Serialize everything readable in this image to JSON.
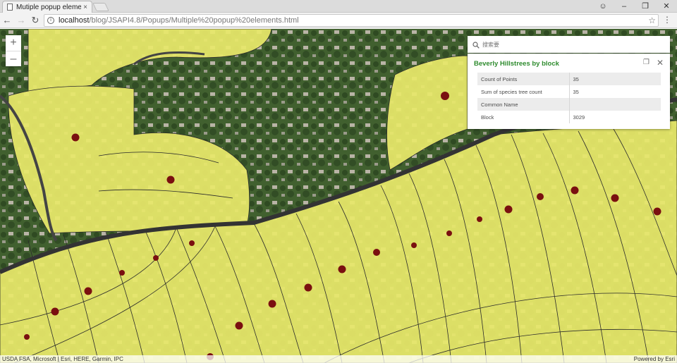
{
  "browser": {
    "tab_title": "Mutiple popup elemen",
    "tab_close": "×",
    "url_host": "localhost",
    "url_path": "/blog/JSAPI4.8/Popups/Multiple%20popup%20elements.html",
    "icons": [
      "document-icon",
      "profile-icon",
      "minimize-icon",
      "restore-icon",
      "close-icon",
      "back-icon",
      "forward-icon",
      "reload-icon",
      "info-icon",
      "star-icon",
      "menu-icon"
    ]
  },
  "map": {
    "zoom_in": "+",
    "zoom_out": "–",
    "attribution": "USDA FSA, Microsoft | Esri, HERE, Garmin, IPC",
    "powered_by": "Powered by Esri",
    "colors": {
      "block_fill": "#e8e86a",
      "block_line": "#2b2b2b",
      "point": "#7a1010",
      "road": "#333333"
    }
  },
  "search": {
    "placeholder": "搜索要"
  },
  "popup": {
    "title": "Beverly Hillstrees by block",
    "title_color": "#2e8b2e",
    "attributes": [
      {
        "field": "Count of Points",
        "value": "35"
      },
      {
        "field": "Sum of species tree count",
        "value": "35"
      },
      {
        "field": "Common Name",
        "value": ""
      },
      {
        "field": "Block",
        "value": "3029"
      }
    ]
  }
}
